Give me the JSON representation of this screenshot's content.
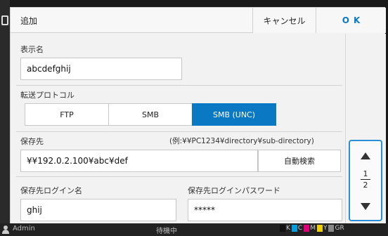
{
  "dialog": {
    "title": "追加",
    "cancel_label": "キャンセル",
    "ok_label": "OK"
  },
  "form": {
    "display_name_label": "表示名",
    "display_name_value": "abcdefghij",
    "protocol_label": "転送プロトコル",
    "protocols": [
      {
        "label": "FTP",
        "selected": false
      },
      {
        "label": "SMB",
        "selected": false
      },
      {
        "label": "SMB (UNC)",
        "selected": true
      }
    ],
    "destination_label": "保存先",
    "destination_hint": "(例:¥¥PC1234¥directory¥sub-directory)",
    "destination_value": "¥¥192.0.2.100¥abc¥def",
    "auto_search_label": "自動検索",
    "login_name_label": "保存先ログイン名",
    "login_name_value": "ghij",
    "password_label": "保存先ログインパスワード",
    "password_value": "*****"
  },
  "pager": {
    "current": "1",
    "total": "2"
  },
  "status": {
    "user": "Admin",
    "state": "待機中",
    "inks": [
      {
        "label": "K",
        "color": "#111111"
      },
      {
        "label": "C",
        "color": "#00a0e0"
      },
      {
        "label": "M",
        "color": "#e0007a"
      },
      {
        "label": "Y",
        "color": "#f0d000"
      },
      {
        "label": "GR",
        "color": "#888888"
      }
    ]
  },
  "colors": {
    "accent": "#0a78c2",
    "pager_border": "#2a8fd6"
  }
}
